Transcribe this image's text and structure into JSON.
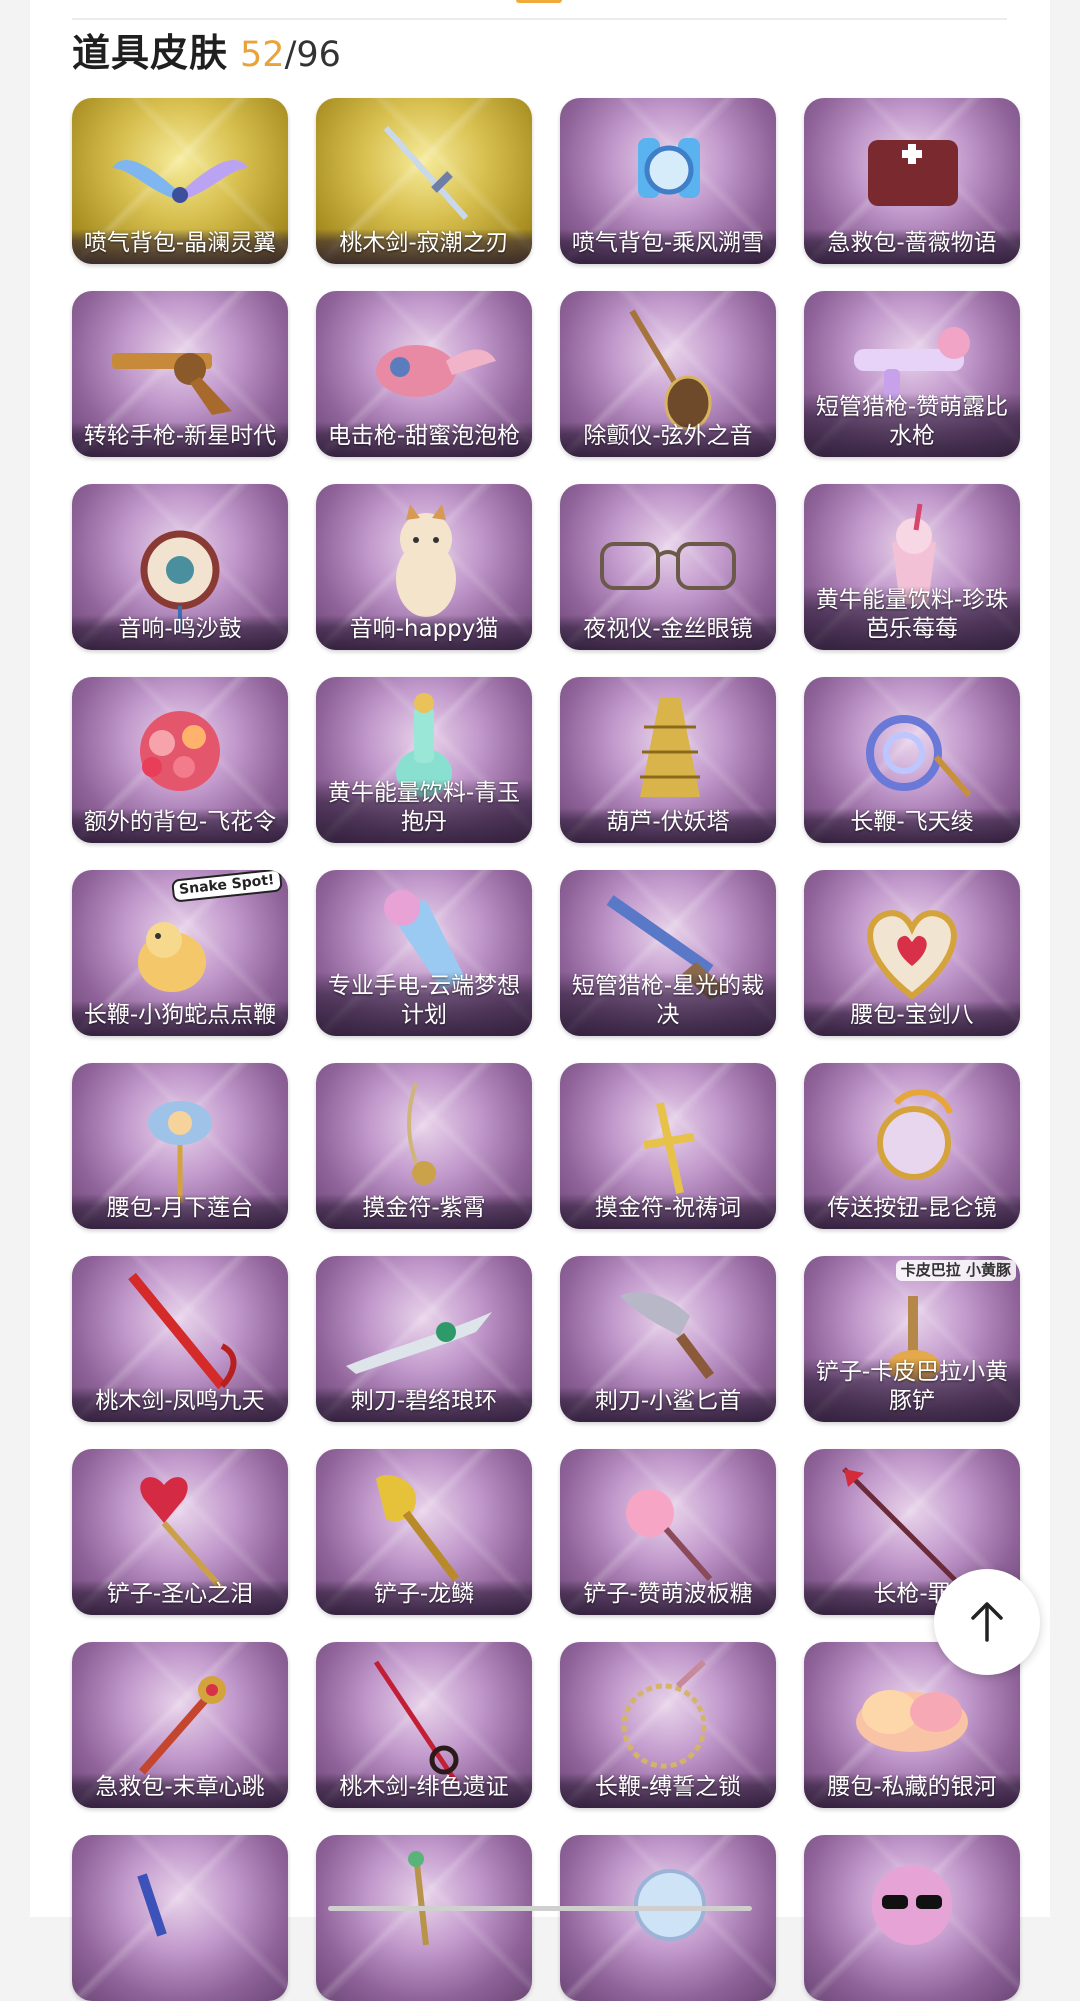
{
  "section": {
    "title": "道具皮肤",
    "owned": "52",
    "separator": "/",
    "total": "96"
  },
  "items": [
    {
      "label": "喷气背包-晶澜灵翼",
      "art": "wings-icon",
      "frame": "gold"
    },
    {
      "label": "桃木剑-寂潮之刃",
      "art": "sword-icon",
      "frame": "gold"
    },
    {
      "label": "喷气背包-乘风溯雪",
      "art": "jetpack-icon",
      "frame": "purple"
    },
    {
      "label": "急救包-蔷薇物语",
      "art": "medkit-icon",
      "frame": "purple"
    },
    {
      "label": "转轮手枪-新星时代",
      "art": "revolver-icon",
      "frame": "purple"
    },
    {
      "label": "电击枪-甜蜜泡泡枪",
      "art": "taser-icon",
      "frame": "purple"
    },
    {
      "label": "除颤仪-弦外之音",
      "art": "lute-icon",
      "frame": "purple"
    },
    {
      "label": "短管猎枪-赞萌露比水枪",
      "art": "water-gun-icon",
      "frame": "purple"
    },
    {
      "label": "音响-鸣沙鼓",
      "art": "drum-icon",
      "frame": "purple"
    },
    {
      "label": "音响-happy猫",
      "art": "cat-icon",
      "frame": "purple"
    },
    {
      "label": "夜视仪-金丝眼镜",
      "art": "glasses-icon",
      "frame": "purple"
    },
    {
      "label": "黄牛能量饮料-珍珠芭乐莓莓",
      "art": "drink-icon",
      "frame": "purple"
    },
    {
      "label": "额外的背包-飞花令",
      "art": "flowers-icon",
      "frame": "purple"
    },
    {
      "label": "黄牛能量饮料-青玉抱丹",
      "art": "bottle-icon",
      "frame": "purple"
    },
    {
      "label": "葫芦-伏妖塔",
      "art": "pagoda-icon",
      "frame": "purple"
    },
    {
      "label": "长鞭-飞天绫",
      "art": "ribbon-icon",
      "frame": "purple"
    },
    {
      "label": "长鞭-小狗蛇点点鞭",
      "art": "snake-icon",
      "frame": "purple",
      "sticker": "Snake Spot!"
    },
    {
      "label": "专业手电-云端梦想计划",
      "art": "flashlight-icon",
      "frame": "purple"
    },
    {
      "label": "短管猎枪-星光的裁决",
      "art": "shotgun-icon",
      "frame": "purple"
    },
    {
      "label": "腰包-宝剑八",
      "art": "heart-icon",
      "frame": "purple"
    },
    {
      "label": "腰包-月下莲台",
      "art": "lotus-icon",
      "frame": "purple"
    },
    {
      "label": "摸金符-紫霄",
      "art": "amulet-icon",
      "frame": "purple"
    },
    {
      "label": "摸金符-祝祷词",
      "art": "cross-icon",
      "frame": "purple"
    },
    {
      "label": "传送按钮-昆仑镜",
      "art": "mirror-icon",
      "frame": "purple"
    },
    {
      "label": "桃木剑-凤鸣九天",
      "art": "red-sword-icon",
      "frame": "purple"
    },
    {
      "label": "刺刀-碧络琅环",
      "art": "dagger-icon",
      "frame": "purple"
    },
    {
      "label": "刺刀-小鲨匕首",
      "art": "shark-icon",
      "frame": "purple"
    },
    {
      "label": "铲子-卡皮巴拉小黄豚铲",
      "art": "capybara-icon",
      "frame": "purple",
      "sticker": "卡皮巴拉 小黄豚"
    },
    {
      "label": "铲子-圣心之泪",
      "art": "heart-shovel-icon",
      "frame": "purple"
    },
    {
      "label": "铲子-龙鳞",
      "art": "gold-shovel-icon",
      "frame": "purple"
    },
    {
      "label": "铲子-赞萌波板糖",
      "art": "lollipop-icon",
      "frame": "purple"
    },
    {
      "label": "长枪-罪",
      "art": "spear-icon",
      "frame": "purple"
    },
    {
      "label": "急救包-末章心跳",
      "art": "scepter-icon",
      "frame": "purple"
    },
    {
      "label": "桃木剑-绯色遗证",
      "art": "rapier-icon",
      "frame": "purple"
    },
    {
      "label": "长鞭-缚誓之锁",
      "art": "chain-icon",
      "frame": "purple"
    },
    {
      "label": "腰包-私藏的银河",
      "art": "cloud-icon",
      "frame": "purple"
    },
    {
      "label": "",
      "art": "wand-icon",
      "frame": "purple"
    },
    {
      "label": "",
      "art": "staff-icon",
      "frame": "purple"
    },
    {
      "label": "",
      "art": "orb-icon",
      "frame": "purple"
    },
    {
      "label": "",
      "art": "sunglasses-cat-icon",
      "frame": "purple"
    }
  ],
  "controls": {
    "scroll_top_icon": "arrow-up-icon"
  },
  "colors": {
    "accent": "#e8a43a",
    "card_purple": "#8f6399",
    "card_gold": "#d8c050"
  }
}
